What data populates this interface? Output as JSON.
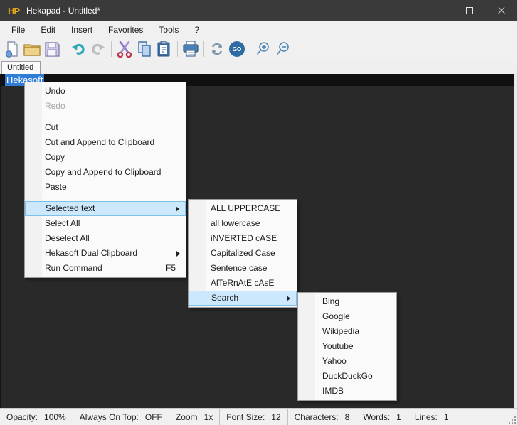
{
  "window": {
    "title": "Hekapad - Untitled*",
    "icon_text": "HP"
  },
  "icons": {
    "app": "HP-gold-logo",
    "minimize": "css-minus",
    "maximize": "css-outline-square",
    "close": "css-x",
    "submenu_arrow": "css-right-triangle",
    "toolbar": [
      "new-file",
      "open-folder",
      "save",
      "undo",
      "redo",
      "cut",
      "copy",
      "paste",
      "print",
      "refresh",
      "go",
      "zoom-in",
      "zoom-out"
    ]
  },
  "menubar": {
    "items": [
      "File",
      "Edit",
      "Insert",
      "Favorites",
      "Tools",
      "?"
    ]
  },
  "toolbar": {
    "go_label": "GO"
  },
  "tabbar": {
    "active_tab": "Untitled"
  },
  "editor": {
    "selected_text": "Hekasoft"
  },
  "context_menu": {
    "items": [
      {
        "label": "Undo",
        "state": "normal"
      },
      {
        "label": "Redo",
        "state": "disabled"
      },
      {
        "type": "separator"
      },
      {
        "label": "Cut"
      },
      {
        "label": "Cut and Append to Clipboard"
      },
      {
        "label": "Copy"
      },
      {
        "label": "Copy and Append to Clipboard"
      },
      {
        "label": "Paste"
      },
      {
        "type": "separator"
      },
      {
        "label": "Selected text",
        "highlighted": true,
        "has_submenu": true
      },
      {
        "label": "Select All"
      },
      {
        "label": "Deselect All"
      },
      {
        "label": "Hekasoft Dual Clipboard",
        "has_submenu": true
      },
      {
        "label": "Run Command",
        "shortcut": "F5"
      }
    ]
  },
  "submenu_case": {
    "items": [
      {
        "label": "ALL UPPERCASE"
      },
      {
        "label": "all lowercase"
      },
      {
        "label": "iNVERTED cASE"
      },
      {
        "label": "Capitalized Case"
      },
      {
        "label": "Sentence case"
      },
      {
        "label": "AlTeRnAtE cAsE"
      },
      {
        "label": "Search",
        "highlighted": true,
        "has_submenu": true
      }
    ]
  },
  "submenu_search": {
    "items": [
      "Bing",
      "Google",
      "Wikipedia",
      "Youtube",
      "Yahoo",
      "DuckDuckGo",
      "IMDB"
    ]
  },
  "statusbar": {
    "segments": [
      {
        "label": "Opacity:",
        "value": "100%"
      },
      {
        "label": "Always On Top:",
        "value": "OFF"
      },
      {
        "label": "Zoom",
        "value": "1x"
      },
      {
        "label": "Font Size:",
        "value": "12"
      },
      {
        "label": "Characters:",
        "value": "8"
      },
      {
        "label": "Words:",
        "value": "1"
      },
      {
        "label": "Lines:",
        "value": "1"
      }
    ]
  },
  "colors": {
    "titlebar_bg": "#3a3a3a",
    "logo_gold": "#e8a81c",
    "chrome_bg": "#f0f0f0",
    "editor_bg": "#292929",
    "editor_line_bg": "#101010",
    "text_selection": "#2e7cd6",
    "menu_bg": "#fafafa",
    "menu_highlight_fill": "#cbe8fc",
    "menu_highlight_border": "#7fc0ea",
    "go_button": "#2e6da4"
  }
}
